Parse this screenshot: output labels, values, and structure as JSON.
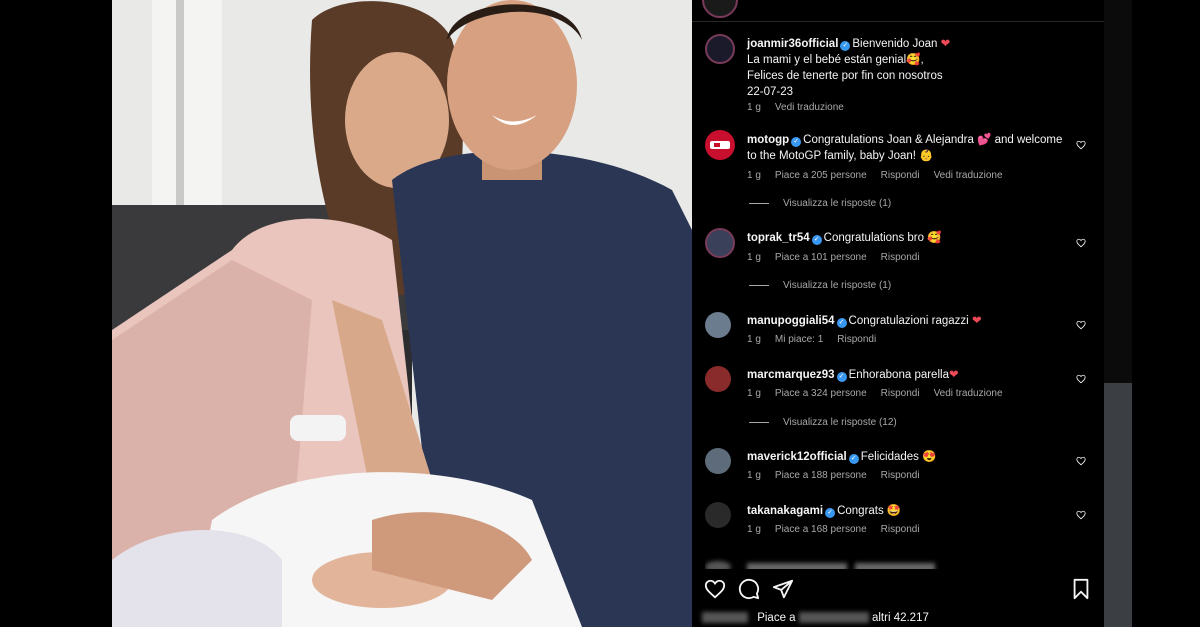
{
  "post": {
    "author": "joanmir36official",
    "caption_line1": "Bienvenido Joan",
    "caption_line2": "La mami y el bebé están genial",
    "caption_line3": "Felices de tenertre por fin con nosotros",
    "caption_line4": "22-07-23",
    "time": "1 g",
    "translate": "Vedi traduzione"
  },
  "comments": [
    {
      "user": "motogp",
      "text_l1": "Congratulations Joan & Alejandra",
      "text_l1_after": "and welcome",
      "text_l2": "to the MotoGP family, baby Joan! 👶",
      "time": "1 g",
      "likes": "Piace a 205 persone",
      "reply": "Rispondi",
      "translate": "Vedi traduzione",
      "replies": "Visualizza le risposte (1)"
    },
    {
      "user": "toprak_tr54",
      "text": "Congratulations bro 🥰",
      "time": "1 g",
      "likes": "Piace a 101 persone",
      "reply": "Rispondi",
      "replies": "Visualizza le risposte (1)"
    },
    {
      "user": "manupoggiali54",
      "text": "Congratulazioni ragazzi",
      "time": "1 g",
      "likes": "Mi piace: 1",
      "reply": "Rispondi"
    },
    {
      "user": "marcmarquez93",
      "text": "Enhorabona parella",
      "time": "1 g",
      "likes": "Piace a 324 persone",
      "reply": "Rispondi",
      "translate": "Vedi traduzione",
      "replies": "Visualizza le risposte (12)"
    },
    {
      "user": "maverick12official",
      "text": "Felicidades 😍",
      "time": "1 g",
      "likes": "Piace a 188 persone",
      "reply": "Rispondi"
    },
    {
      "user": "takanakagami",
      "text": "Congrats 🤩",
      "time": "1 g",
      "likes": "Piace a 168 persone",
      "reply": "Rispondi"
    }
  ],
  "footer": {
    "likes_prefix": "Piace a",
    "likes_suffix": "altri 42.217"
  },
  "colors": {
    "heart_red": "#ed4956",
    "verified_blue": "#3897f0",
    "muted": "#a8a8a8"
  },
  "icons": [
    "heart-icon",
    "comment-icon",
    "share-icon",
    "bookmark-icon"
  ]
}
